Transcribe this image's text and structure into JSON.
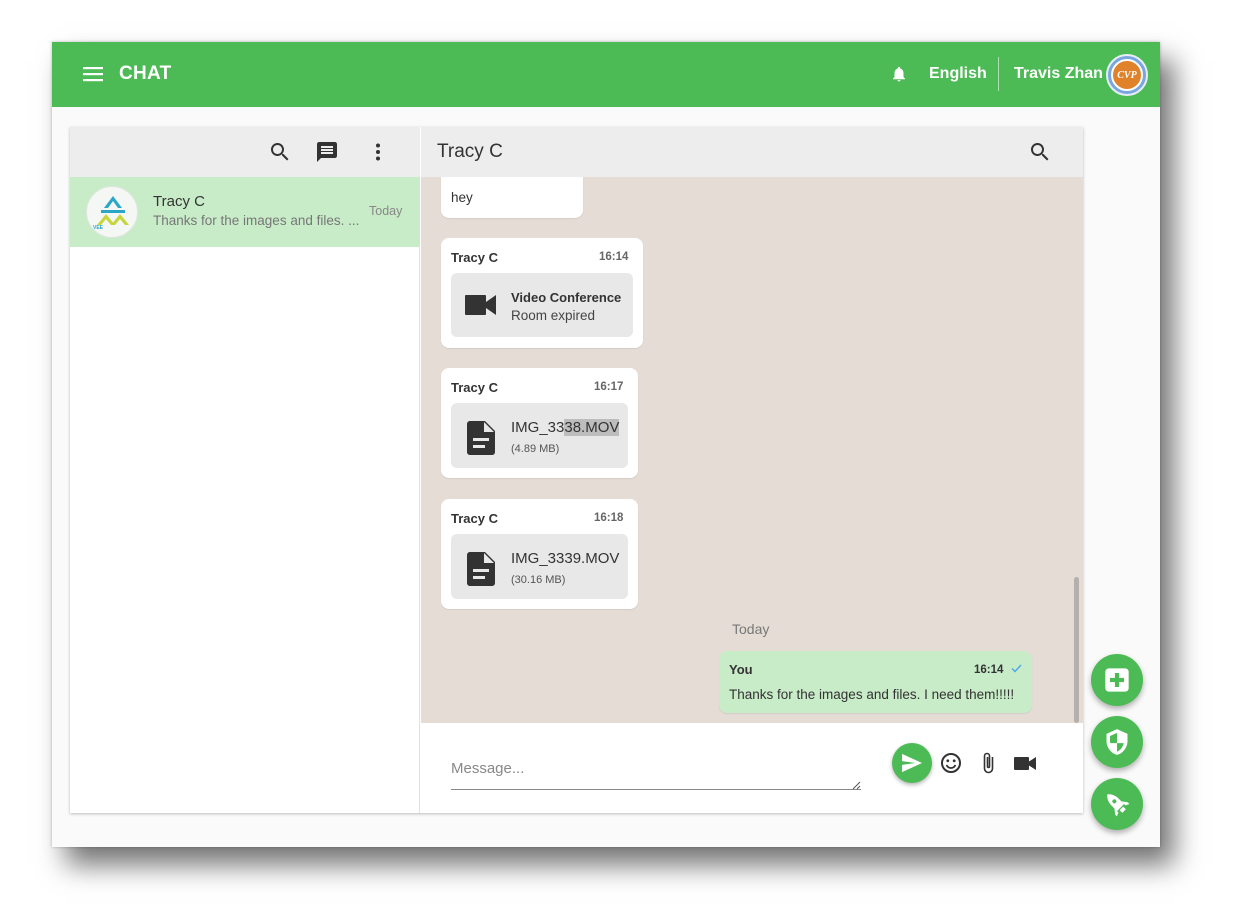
{
  "topbar": {
    "title": "CHAT",
    "language": "English",
    "user_name": "Travis Zhan",
    "avatar_text": "CVP",
    "icons": [
      "menu-icon",
      "bell-icon"
    ]
  },
  "sidebar": {
    "header_icons": [
      "search-icon",
      "new-chat-icon",
      "more-vert-icon"
    ],
    "conversations": [
      {
        "name": "Tracy C",
        "preview": "Thanks for the images and files. ...",
        "time": "Today",
        "avatar_text": "VEE"
      }
    ]
  },
  "chat": {
    "title": "Tracy C",
    "messages": [
      {
        "text": "hey"
      },
      {
        "sender": "Tracy C",
        "time": "16:14",
        "attachment": {
          "icon": "videocam-icon",
          "title": "Video Conference",
          "subtitle": "Room expired"
        }
      },
      {
        "sender": "Tracy C",
        "time": "16:17",
        "attachment": {
          "icon": "file-icon",
          "title_a": "IMG_33",
          "title_b": "38.MOV",
          "subtitle": "(4.89 MB)"
        }
      },
      {
        "sender": "Tracy C",
        "time": "16:18",
        "attachment": {
          "icon": "file-icon",
          "title": "IMG_3339.MOV",
          "subtitle": "(30.16 MB)"
        }
      }
    ],
    "date_separator": "Today",
    "my_message": {
      "sender": "You",
      "time": "16:14",
      "text": "Thanks for the images and files. I need them!!!!!",
      "status": "check-icon"
    }
  },
  "composer": {
    "placeholder": "Message...",
    "icons": [
      "send-icon",
      "emoji-icon",
      "attach-icon",
      "videocam-icon"
    ]
  },
  "fabs": [
    "add-box-icon",
    "shield-icon",
    "rocket-icon"
  ],
  "colors": {
    "brand_green": "#4dbb55",
    "selected_green": "#c8ebc8",
    "chat_background": "#e5ddd5",
    "header_grey": "#ededed"
  }
}
